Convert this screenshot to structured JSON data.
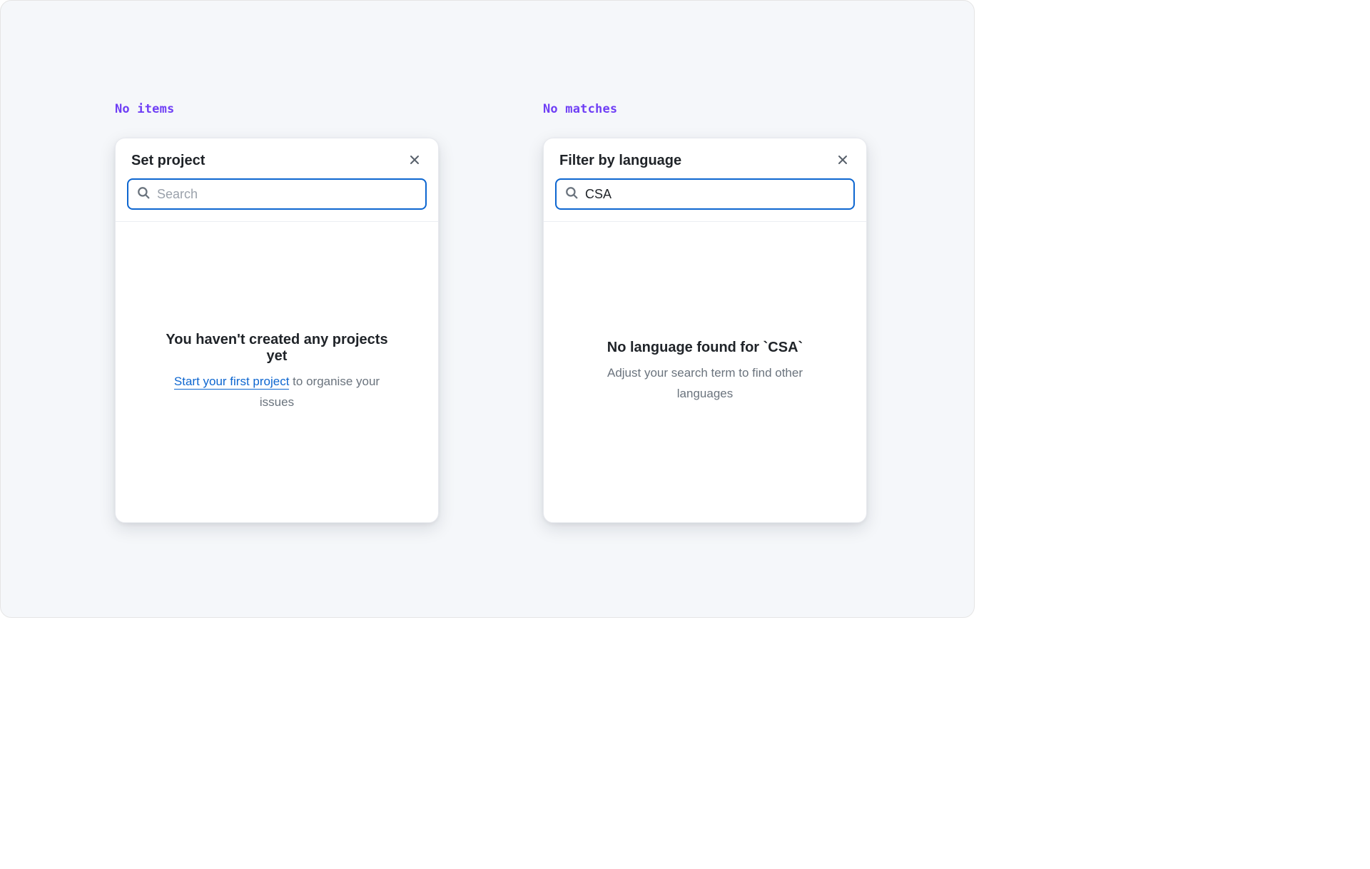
{
  "labels": {
    "left": "No items",
    "right": "No matches"
  },
  "panels": {
    "left": {
      "title": "Set project",
      "search": {
        "placeholder": "Search",
        "value": ""
      },
      "empty": {
        "title": "You haven't created any projects yet",
        "link_text": "Start your first project",
        "sub_rest": " to organise your issues"
      }
    },
    "right": {
      "title": "Filter by language",
      "search": {
        "placeholder": "",
        "value": "CSA"
      },
      "empty": {
        "title": "No language found for `CSA`",
        "sub": "Adjust your search term to find other languages"
      }
    }
  },
  "icons": {
    "search": "search-icon",
    "close": "close-icon"
  },
  "colors": {
    "accent_purple": "#6f3ff5",
    "focus_blue": "#0d66d0",
    "text_primary": "#1f2328",
    "text_secondary": "#6a737d",
    "panel_bg": "#ffffff",
    "page_bg": "#f5f7fa"
  }
}
